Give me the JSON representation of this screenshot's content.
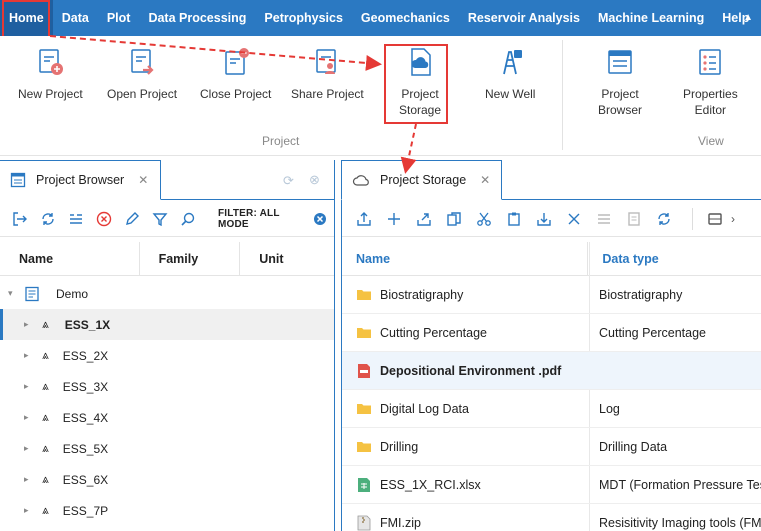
{
  "menu": {
    "items": [
      "Home",
      "Data",
      "Plot",
      "Data Processing",
      "Petrophysics",
      "Geomechanics",
      "Reservoir Analysis",
      "Machine Learning",
      "Help"
    ],
    "collapse_icon": "caret-up-icon"
  },
  "ribbon": {
    "buttons": {
      "new_project": {
        "label": "New Project",
        "icon": "new-project-icon"
      },
      "open_project": {
        "label": "Open Project",
        "icon": "open-project-icon"
      },
      "close_project": {
        "label": "Close Project",
        "icon": "close-project-icon"
      },
      "share_project": {
        "label": "Share Project",
        "icon": "share-project-icon"
      },
      "project_storage": {
        "label_line1": "Project",
        "label_line2": "Storage",
        "icon": "cloud-storage-icon"
      },
      "new_well": {
        "label": "New Well",
        "icon": "oil-derrick-icon"
      },
      "project_browser": {
        "label_line1": "Project",
        "label_line2": "Browser",
        "icon": "project-browser-icon"
      },
      "properties_editor": {
        "label_line1": "Properties",
        "label_line2": "Editor",
        "icon": "properties-editor-icon"
      }
    },
    "groups": {
      "project": "Project",
      "view": "View"
    }
  },
  "left_panel": {
    "tab_title": "Project Browser",
    "filter_label": "FILTER: ALL MODE",
    "columns": [
      "Name",
      "Family",
      "Unit"
    ],
    "root": "Demo",
    "wells": [
      "ESS_1X",
      "ESS_2X",
      "ESS_3X",
      "ESS_4X",
      "ESS_5X",
      "ESS_6X",
      "ESS_7P"
    ],
    "selected_well": "ESS_1X"
  },
  "right_panel": {
    "tab_title": "Project Storage",
    "columns": [
      "Name",
      "Data type"
    ],
    "rows": [
      {
        "name": "Biostratigraphy",
        "type": "Biostratigraphy",
        "kind": "folder"
      },
      {
        "name": "Cutting Percentage",
        "type": "Cutting Percentage",
        "kind": "folder"
      },
      {
        "name": "Depositional Environment .pdf",
        "type": "",
        "kind": "pdf"
      },
      {
        "name": "Digital Log Data",
        "type": "Log",
        "kind": "folder"
      },
      {
        "name": "Drilling",
        "type": "Drilling Data",
        "kind": "folder"
      },
      {
        "name": "ESS_1X_RCI.xlsx",
        "type": "MDT (Formation Pressure Test)",
        "kind": "xlsx"
      },
      {
        "name": "FMI.zip",
        "type": "Resisitivity Imaging tools (FMI,",
        "kind": "zip"
      }
    ]
  },
  "colors": {
    "accent": "#2b79c2",
    "highlight": "#e53935",
    "folder": "#f5c242"
  }
}
